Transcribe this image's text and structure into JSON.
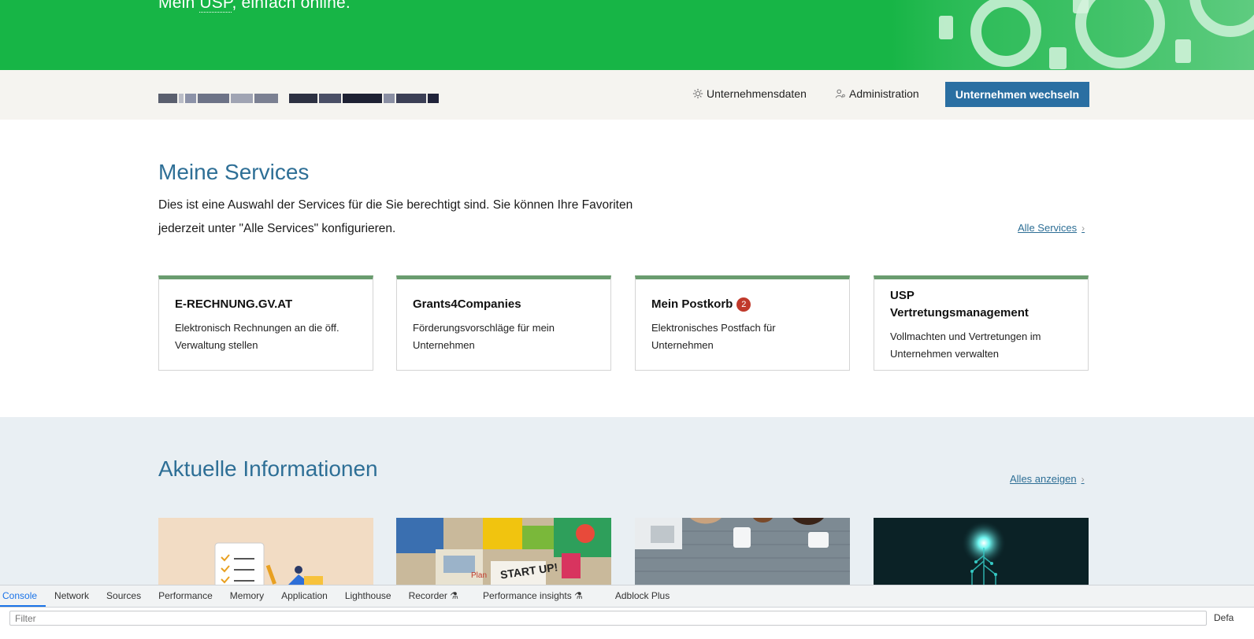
{
  "hero": {
    "prefix": "Mein ",
    "abbr": "USP",
    "suffix": ", einfach online."
  },
  "company_bar": {
    "nav": [
      {
        "label": "Unternehmensdaten",
        "icon": "gear-icon"
      },
      {
        "label": "Administration",
        "icon": "user-gear-icon"
      }
    ],
    "switch_button": "Unternehmen wechseln"
  },
  "services": {
    "heading": "Meine Services",
    "intro": "Dies ist eine Auswahl der Services für die Sie berechtigt sind. Sie können Ihre Favoriten jederzeit unter \"Alle Services\" konfigurieren.",
    "all_link": "Alle Services",
    "cards": [
      {
        "title": "E-RECHNUNG.GV.AT",
        "desc": "Elektronisch Rechnungen an die öff. Verwaltung stellen"
      },
      {
        "title": "Grants4Companies",
        "desc": "Förderungsvorschläge für mein Unternehmen"
      },
      {
        "title": "Mein Postkorb",
        "badge": "2",
        "desc": "Elektronisches Postfach für Unternehmen"
      },
      {
        "title": "USP Vertretungsmanagement",
        "desc": "Vollmachten und Vertretungen im Unternehmen verwalten"
      }
    ]
  },
  "news": {
    "heading": "Aktuelle Informationen",
    "all_link": "Alles anzeigen"
  },
  "devtools": {
    "tabs": [
      "Console",
      "Network",
      "Sources",
      "Performance",
      "Memory",
      "Application",
      "Lighthouse",
      "Recorder",
      "Performance insights",
      "Adblock Plus"
    ],
    "filter_placeholder": "Filter",
    "levels": "Defa"
  }
}
